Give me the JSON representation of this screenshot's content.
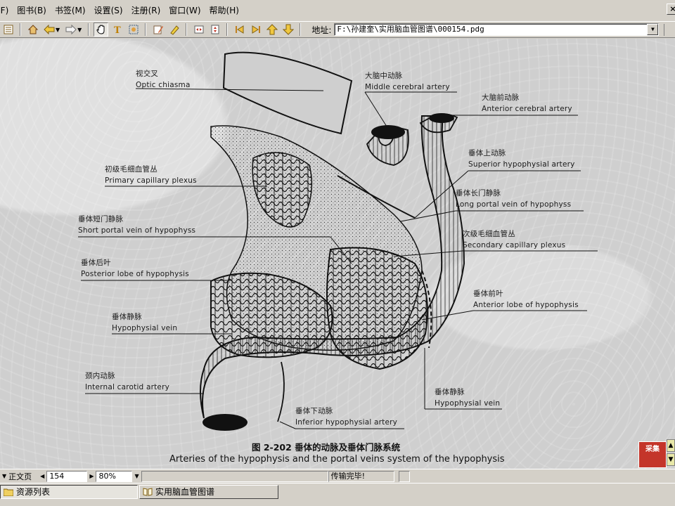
{
  "menu": {
    "items": [
      "(F)",
      "图书(B)",
      "书签(M)",
      "设置(S)",
      "注册(R)",
      "窗口(W)",
      "帮助(H)"
    ]
  },
  "toolbar": {
    "address_label": "地址:",
    "address_value": "F:\\孙建奎\\实用脑血管图谱\\000154.pdg"
  },
  "figure": {
    "labels": [
      {
        "cn": "视交叉",
        "en": "Optic chiasma"
      },
      {
        "cn": "大脑中动脉",
        "en": "Middle cerebral artery"
      },
      {
        "cn": "大脑前动脉",
        "en": "Anterior cerebral artery"
      },
      {
        "cn": "垂体上动脉",
        "en": "Superior hypophysial artery"
      },
      {
        "cn": "初级毛细血管丛",
        "en": "Primary capillary plexus"
      },
      {
        "cn": "垂体长门静脉",
        "en": "Long portal vein of hypophyss"
      },
      {
        "cn": "垂体短门静脉",
        "en": "Short portal vein of hypophyss"
      },
      {
        "cn": "次级毛细血管丛",
        "en": "Secondary capillary plexus"
      },
      {
        "cn": "垂体后叶",
        "en": "Posterior lobe of hypophysis"
      },
      {
        "cn": "垂体前叶",
        "en": "Anterior lobe of hypophysis"
      },
      {
        "cn": "垂体静脉",
        "en": "Hypophysial vein"
      },
      {
        "cn": "颈内动脉",
        "en": "Internal carotid artery"
      },
      {
        "cn": "垂体静脉",
        "en": "Hypophysial vein"
      },
      {
        "cn": "垂体下动脉",
        "en": "Inferior hypophysial artery"
      }
    ],
    "caption_cn": "图 2-202   垂体的动脉及垂体门脉系统",
    "caption_en": "Arteries of the hypophysis and the portal veins system of the hypophysis"
  },
  "float_logo": "采集",
  "statusbar": {
    "view_mode": "正文页",
    "page_number": "154",
    "zoom": "80%",
    "status_text": "传输完毕!"
  },
  "taskbar": {
    "resource_list": "资源列表",
    "window_title": "实用脑血管图谱"
  }
}
